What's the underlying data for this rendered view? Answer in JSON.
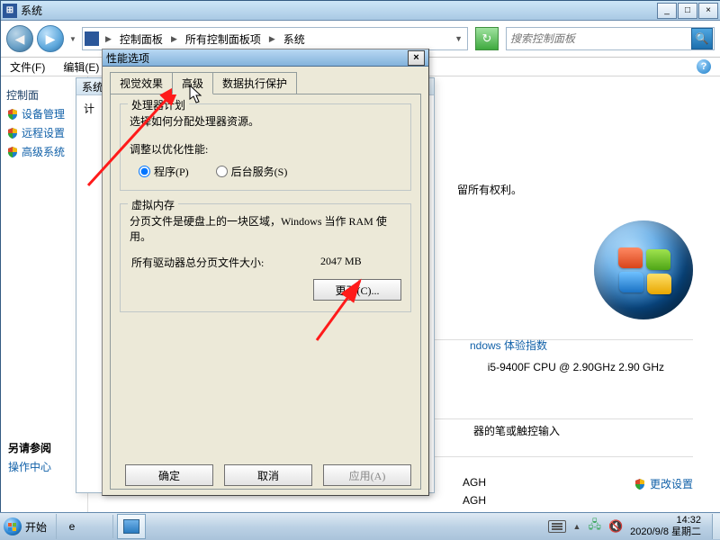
{
  "syswin": {
    "title": "系统",
    "btn_min": "_",
    "btn_max": "□",
    "btn_close": "×",
    "crumbs": {
      "c1": "控制面板",
      "c2": "所有控制面板项",
      "c3": "系统"
    },
    "search_placeholder": "搜索控制面板",
    "menu": {
      "file": "文件(F)",
      "edit": "编辑(E)"
    },
    "leftnav": {
      "header": "控制面",
      "l1": "设备管理",
      "l2": "远程设置",
      "l3": "高级系统",
      "footer_h": "另请参阅",
      "footer_1": "操作中心"
    },
    "content": {
      "rights": "留所有权利。",
      "wei": "ndows 体验指数",
      "cpu": "i5-9400F CPU @ 2.90GHz   2.90 GHz",
      "pen": "器的笔或触控输入",
      "agh1": "AGH",
      "agh2": "AGH",
      "change_settings": "更改设置"
    }
  },
  "subwin": {
    "tabs_sys": "系统",
    "tabs_comp": "计"
  },
  "dialog": {
    "title": "性能选项",
    "close": "×",
    "tabs": {
      "visual": "视觉效果",
      "advanced": "高级",
      "dep": "数据执行保护"
    },
    "sched": {
      "legend": "处理器计划",
      "desc": "选择如何分配处理器资源。",
      "adjust": "调整以优化性能:",
      "r1": "程序(P)",
      "r2": "后台服务(S)"
    },
    "vm": {
      "legend": "虚拟内存",
      "desc": "分页文件是硬盘上的一块区域，Windows 当作 RAM 使用。",
      "totlabel": "所有驱动器总分页文件大小:",
      "totval": "2047 MB",
      "change": "更改(C)..."
    },
    "buttons": {
      "ok": "确定",
      "cancel": "取消",
      "apply": "应用(A)"
    }
  },
  "taskbar": {
    "start": "开始",
    "time": "14:32",
    "date": "2020/9/8 星期二"
  }
}
